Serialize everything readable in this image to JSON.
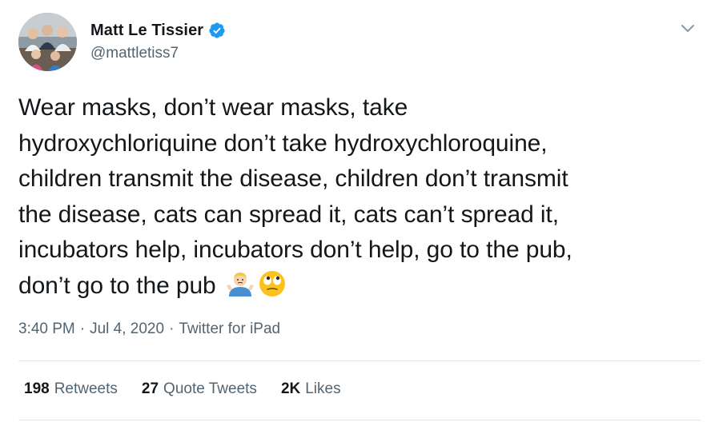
{
  "author": {
    "display_name": "Matt Le Tissier",
    "handle": "@mattletiss7",
    "verified": true,
    "verified_color": "#1d9bf0"
  },
  "tweet": {
    "lines": [
      "Wear masks, don’t wear masks, take",
      "hydroxychloriquine don’t take hydroxychloroquine,",
      "children transmit the disease, children don’t transmit",
      "the disease, cats can spread it, cats can’t spread it,",
      "incubators help, incubators don’t help, go to the pub,",
      "don’t go to the pub"
    ],
    "emoji": [
      "man-shrugging-emoji",
      "face-with-rolling-eyes-emoji"
    ]
  },
  "meta": {
    "time": "3:40 PM",
    "separator1": "·",
    "date": "Jul 4, 2020",
    "separator2": "·",
    "source": "Twitter for iPad"
  },
  "stats": {
    "retweets": {
      "count": "198",
      "label": "Retweets"
    },
    "quote_tweets": {
      "count": "27",
      "label": "Quote Tweets"
    },
    "likes": {
      "count": "2K",
      "label": "Likes"
    }
  },
  "icons": {
    "menu": "chevron-down-icon",
    "verified": "verified-badge-icon"
  }
}
